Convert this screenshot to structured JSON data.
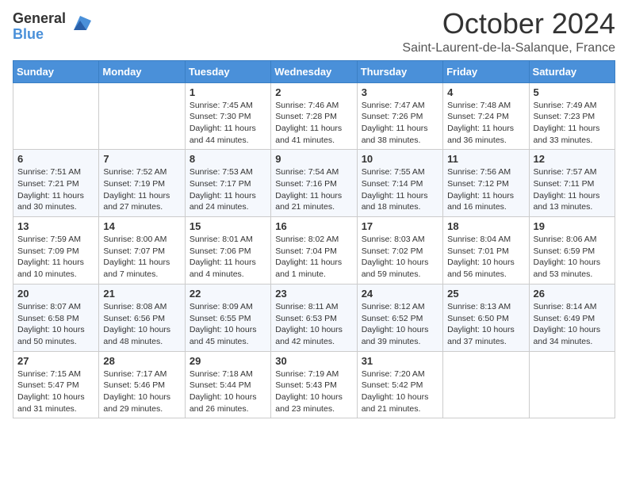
{
  "header": {
    "logo_general": "General",
    "logo_blue": "Blue",
    "month_title": "October 2024",
    "location": "Saint-Laurent-de-la-Salanque, France"
  },
  "weekdays": [
    "Sunday",
    "Monday",
    "Tuesday",
    "Wednesday",
    "Thursday",
    "Friday",
    "Saturday"
  ],
  "weeks": [
    [
      {
        "day": "",
        "lines": []
      },
      {
        "day": "",
        "lines": []
      },
      {
        "day": "1",
        "lines": [
          "Sunrise: 7:45 AM",
          "Sunset: 7:30 PM",
          "Daylight: 11 hours and 44 minutes."
        ]
      },
      {
        "day": "2",
        "lines": [
          "Sunrise: 7:46 AM",
          "Sunset: 7:28 PM",
          "Daylight: 11 hours and 41 minutes."
        ]
      },
      {
        "day": "3",
        "lines": [
          "Sunrise: 7:47 AM",
          "Sunset: 7:26 PM",
          "Daylight: 11 hours and 38 minutes."
        ]
      },
      {
        "day": "4",
        "lines": [
          "Sunrise: 7:48 AM",
          "Sunset: 7:24 PM",
          "Daylight: 11 hours and 36 minutes."
        ]
      },
      {
        "day": "5",
        "lines": [
          "Sunrise: 7:49 AM",
          "Sunset: 7:23 PM",
          "Daylight: 11 hours and 33 minutes."
        ]
      }
    ],
    [
      {
        "day": "6",
        "lines": [
          "Sunrise: 7:51 AM",
          "Sunset: 7:21 PM",
          "Daylight: 11 hours and 30 minutes."
        ]
      },
      {
        "day": "7",
        "lines": [
          "Sunrise: 7:52 AM",
          "Sunset: 7:19 PM",
          "Daylight: 11 hours and 27 minutes."
        ]
      },
      {
        "day": "8",
        "lines": [
          "Sunrise: 7:53 AM",
          "Sunset: 7:17 PM",
          "Daylight: 11 hours and 24 minutes."
        ]
      },
      {
        "day": "9",
        "lines": [
          "Sunrise: 7:54 AM",
          "Sunset: 7:16 PM",
          "Daylight: 11 hours and 21 minutes."
        ]
      },
      {
        "day": "10",
        "lines": [
          "Sunrise: 7:55 AM",
          "Sunset: 7:14 PM",
          "Daylight: 11 hours and 18 minutes."
        ]
      },
      {
        "day": "11",
        "lines": [
          "Sunrise: 7:56 AM",
          "Sunset: 7:12 PM",
          "Daylight: 11 hours and 16 minutes."
        ]
      },
      {
        "day": "12",
        "lines": [
          "Sunrise: 7:57 AM",
          "Sunset: 7:11 PM",
          "Daylight: 11 hours and 13 minutes."
        ]
      }
    ],
    [
      {
        "day": "13",
        "lines": [
          "Sunrise: 7:59 AM",
          "Sunset: 7:09 PM",
          "Daylight: 11 hours and 10 minutes."
        ]
      },
      {
        "day": "14",
        "lines": [
          "Sunrise: 8:00 AM",
          "Sunset: 7:07 PM",
          "Daylight: 11 hours and 7 minutes."
        ]
      },
      {
        "day": "15",
        "lines": [
          "Sunrise: 8:01 AM",
          "Sunset: 7:06 PM",
          "Daylight: 11 hours and 4 minutes."
        ]
      },
      {
        "day": "16",
        "lines": [
          "Sunrise: 8:02 AM",
          "Sunset: 7:04 PM",
          "Daylight: 11 hours and 1 minute."
        ]
      },
      {
        "day": "17",
        "lines": [
          "Sunrise: 8:03 AM",
          "Sunset: 7:02 PM",
          "Daylight: 10 hours and 59 minutes."
        ]
      },
      {
        "day": "18",
        "lines": [
          "Sunrise: 8:04 AM",
          "Sunset: 7:01 PM",
          "Daylight: 10 hours and 56 minutes."
        ]
      },
      {
        "day": "19",
        "lines": [
          "Sunrise: 8:06 AM",
          "Sunset: 6:59 PM",
          "Daylight: 10 hours and 53 minutes."
        ]
      }
    ],
    [
      {
        "day": "20",
        "lines": [
          "Sunrise: 8:07 AM",
          "Sunset: 6:58 PM",
          "Daylight: 10 hours and 50 minutes."
        ]
      },
      {
        "day": "21",
        "lines": [
          "Sunrise: 8:08 AM",
          "Sunset: 6:56 PM",
          "Daylight: 10 hours and 48 minutes."
        ]
      },
      {
        "day": "22",
        "lines": [
          "Sunrise: 8:09 AM",
          "Sunset: 6:55 PM",
          "Daylight: 10 hours and 45 minutes."
        ]
      },
      {
        "day": "23",
        "lines": [
          "Sunrise: 8:11 AM",
          "Sunset: 6:53 PM",
          "Daylight: 10 hours and 42 minutes."
        ]
      },
      {
        "day": "24",
        "lines": [
          "Sunrise: 8:12 AM",
          "Sunset: 6:52 PM",
          "Daylight: 10 hours and 39 minutes."
        ]
      },
      {
        "day": "25",
        "lines": [
          "Sunrise: 8:13 AM",
          "Sunset: 6:50 PM",
          "Daylight: 10 hours and 37 minutes."
        ]
      },
      {
        "day": "26",
        "lines": [
          "Sunrise: 8:14 AM",
          "Sunset: 6:49 PM",
          "Daylight: 10 hours and 34 minutes."
        ]
      }
    ],
    [
      {
        "day": "27",
        "lines": [
          "Sunrise: 7:15 AM",
          "Sunset: 5:47 PM",
          "Daylight: 10 hours and 31 minutes."
        ]
      },
      {
        "day": "28",
        "lines": [
          "Sunrise: 7:17 AM",
          "Sunset: 5:46 PM",
          "Daylight: 10 hours and 29 minutes."
        ]
      },
      {
        "day": "29",
        "lines": [
          "Sunrise: 7:18 AM",
          "Sunset: 5:44 PM",
          "Daylight: 10 hours and 26 minutes."
        ]
      },
      {
        "day": "30",
        "lines": [
          "Sunrise: 7:19 AM",
          "Sunset: 5:43 PM",
          "Daylight: 10 hours and 23 minutes."
        ]
      },
      {
        "day": "31",
        "lines": [
          "Sunrise: 7:20 AM",
          "Sunset: 5:42 PM",
          "Daylight: 10 hours and 21 minutes."
        ]
      },
      {
        "day": "",
        "lines": []
      },
      {
        "day": "",
        "lines": []
      }
    ]
  ]
}
